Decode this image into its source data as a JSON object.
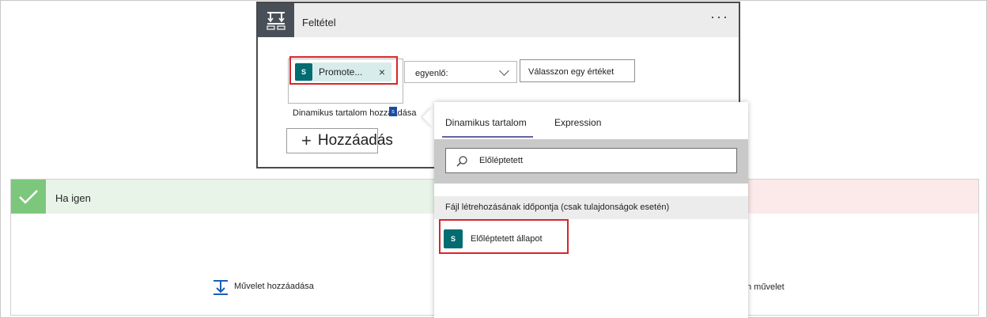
{
  "condition": {
    "title": "Feltétel",
    "token_label": "Promote...",
    "token_close": "×",
    "token_icon_text": "S",
    "dynamic_link": "Dinamikus tartalom hozzáadása",
    "operator": "egyenlő:",
    "value_placeholder": "Válasszon egy értéket",
    "add_button": "Hozzáadás"
  },
  "branch": {
    "yes_title": "Ha igen",
    "add_action": "Művelet hozzáadása",
    "other_action_fragment": "n művelet"
  },
  "panel": {
    "tabs": [
      "Dinamikus tartalom",
      "Expression"
    ],
    "search_value": "Előléptetett",
    "section_title": "Fájl létrehozásának időpontja (csak tulajdonságok esetén)",
    "result_label": "Előléptetett állapot"
  },
  "colors": {
    "highlight": "#d9252a",
    "tab_accent": "#6264a7",
    "sharepoint": "#036c70",
    "yes_green": "#7dc77d",
    "no_red_bg": "#fce9ea"
  },
  "icons": {
    "condition": "condition-icon",
    "more": "more-icon",
    "sharepoint": "sharepoint-icon",
    "close": "close-icon",
    "chevron": "chevron-down-icon",
    "plus": "plus-icon",
    "check": "check-icon",
    "add_action": "add-action-icon",
    "search": "search-icon"
  }
}
